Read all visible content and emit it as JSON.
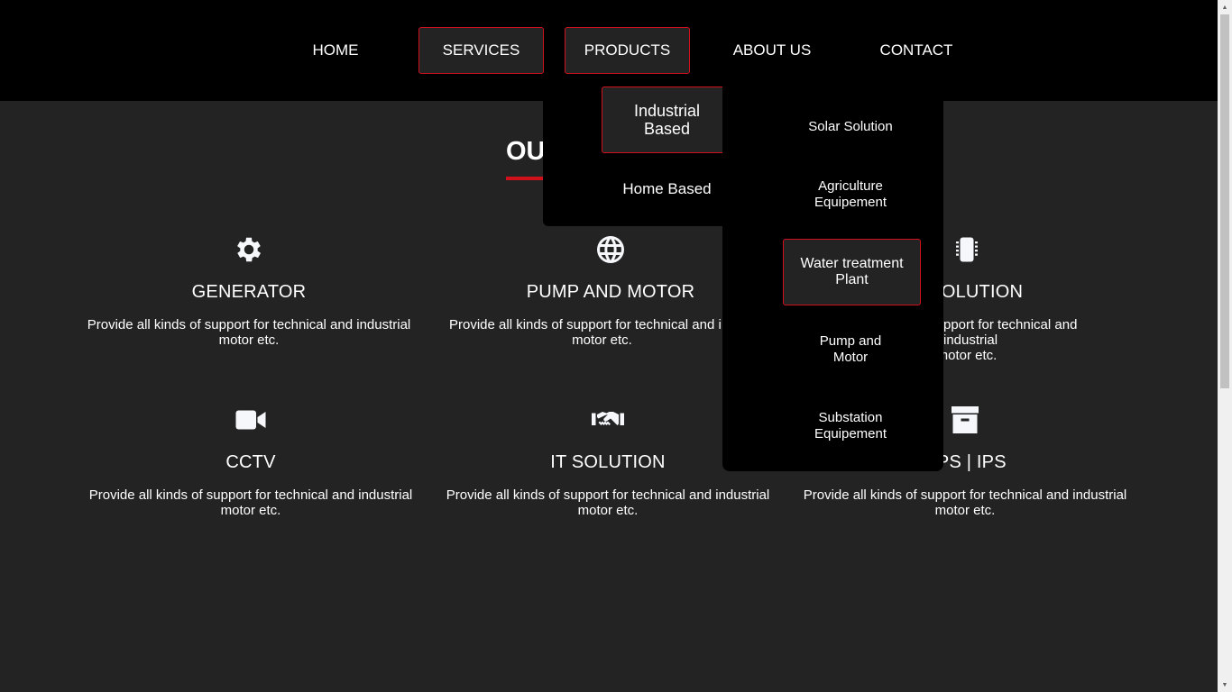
{
  "nav": {
    "home": "HOME",
    "services": "SERVICES",
    "products": "PRODUCTS",
    "about": "ABOUT US",
    "contact": "CONTACT"
  },
  "section": {
    "title": "OU"
  },
  "cards": [
    {
      "icon": "gear-icon",
      "title": "GENERATOR",
      "text": "Provide all kinds of support for technical and industrial motor etc."
    },
    {
      "icon": "globe-icon",
      "title": "PUMP AND MOTOR",
      "text": "Provide all kinds of support for technical and i",
      "text2": "motor etc."
    },
    {
      "icon": "chip-icon",
      "title": "R SOLUTION",
      "text": "pport for technical and industrial",
      "text2": "motor etc."
    },
    {
      "icon": "video-camera-icon",
      "title": "CCTV",
      "text": "Provide all kinds of support for technical and industrial motor etc."
    },
    {
      "icon": "handshake-icon",
      "title": "IT SOLUTION",
      "text": "Provide all kinds of support for technical and industrial motor etc."
    },
    {
      "icon": "archive-icon",
      "title": "UPS | IPS",
      "title_visible": "PS | IPS",
      "text": "Provide all kinds of support for technical and industrial motor etc."
    }
  ],
  "products_menu": {
    "industrial": "Industrial Based",
    "home": "Home Based"
  },
  "industrial_submenu": {
    "solar": "Solar Solution",
    "agriculture": "Agriculture Equipement",
    "water": "Water treatment Plant",
    "pump": "Pump and Motor",
    "substation": "Substation Equipement"
  },
  "colors": {
    "accent": "#d0101a",
    "nav_bg": "#000000",
    "page_bg": "#232323"
  }
}
